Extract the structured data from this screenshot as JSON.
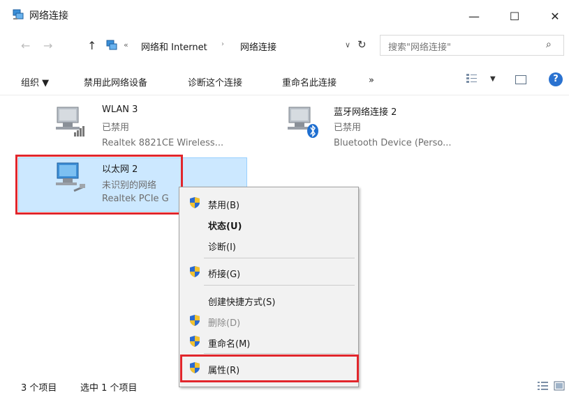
{
  "window": {
    "title": "网络连接",
    "minimize": "—",
    "maximize": "☐",
    "close": "✕"
  },
  "address": {
    "chevron": "«",
    "crumbs": [
      "网络和 Internet",
      "网络连接"
    ],
    "separator": "›",
    "dropdown": "∨",
    "refresh": "↻",
    "up": "↑",
    "back": "←",
    "forward": "→"
  },
  "search": {
    "placeholder": "搜索\"网络连接\"",
    "icon": "⌕"
  },
  "toolbar": {
    "organize": "组织 ▼",
    "disable": "禁用此网络设备",
    "diagnose": "诊断这个连接",
    "rename": "重命名此连接",
    "more": "»",
    "view_dd": "▼",
    "help": "?"
  },
  "items": [
    {
      "name": "WLAN 3",
      "status": "已禁用",
      "device": "Realtek 8821CE Wireless..."
    },
    {
      "name": "蓝牙网络连接 2",
      "status": "已禁用",
      "device": "Bluetooth Device (Perso..."
    },
    {
      "name": "以太网 2",
      "status": "未识别的网络",
      "device": "Realtek PCIe G"
    }
  ],
  "context_menu": {
    "items": [
      {
        "label": "禁用(B)",
        "icon": "shield-icon",
        "enabled": true,
        "bold": false
      },
      {
        "label": "状态(U)",
        "icon": "",
        "enabled": true,
        "bold": true
      },
      {
        "label": "诊断(I)",
        "icon": "",
        "enabled": true,
        "bold": false
      },
      {
        "label": "桥接(G)",
        "icon": "shield-icon",
        "enabled": true,
        "bold": false
      },
      {
        "label": "创建快捷方式(S)",
        "icon": "",
        "enabled": true,
        "bold": false
      },
      {
        "label": "删除(D)",
        "icon": "shield-icon",
        "enabled": false,
        "bold": false
      },
      {
        "label": "重命名(M)",
        "icon": "shield-icon",
        "enabled": true,
        "bold": false
      },
      {
        "label": "属性(R)",
        "icon": "shield-icon",
        "enabled": true,
        "bold": false
      }
    ]
  },
  "statusbar": {
    "count": "3 个项目",
    "selected": "选中 1 个项目"
  },
  "colors": {
    "selection": "#cce8ff",
    "highlight_red": "#e1262c",
    "accent": "#2a72d0"
  }
}
